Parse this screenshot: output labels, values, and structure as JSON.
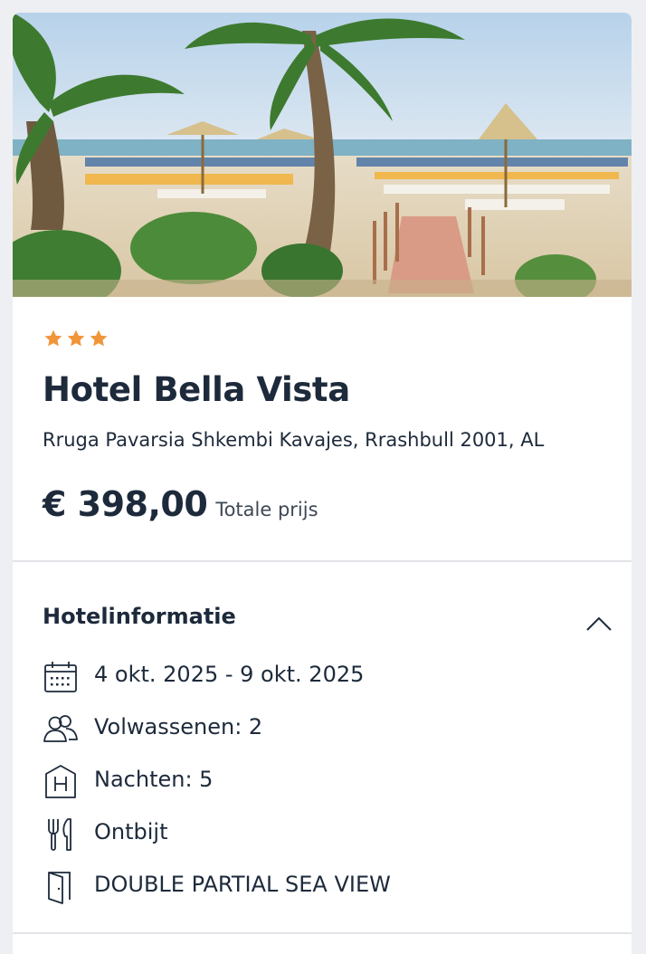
{
  "hotel": {
    "star_rating": 3,
    "star_icon": "star-icon",
    "star_color": "#f1953a",
    "name": "Hotel Bella Vista",
    "address": "Rruga Pavarsia Shkembi Kavajes, Rrashbull 2001, AL",
    "price": "€ 398,00",
    "price_label": "Totale prijs",
    "image_alt": "beach with palm trees, umbrellas and sun loungers"
  },
  "hotel_info": {
    "title": "Hotelinformatie",
    "expanded": true,
    "toggle_icon": "chevron-up-icon",
    "items": [
      {
        "icon": "calendar-icon",
        "label": "4 okt. 2025 - 9 okt. 2025"
      },
      {
        "icon": "adults-icon",
        "label": "Volwassenen: 2"
      },
      {
        "icon": "hotel-icon",
        "label": "Nachten: 5"
      },
      {
        "icon": "fork-knife-icon",
        "label": "Ontbijt"
      },
      {
        "icon": "door-icon",
        "label": "DOUBLE PARTIAL SEA VIEW"
      }
    ]
  },
  "colors": {
    "text": "#1d2a3b",
    "star": "#f1953a",
    "divider": "#e2e4e8",
    "background": "#eeeff2"
  }
}
